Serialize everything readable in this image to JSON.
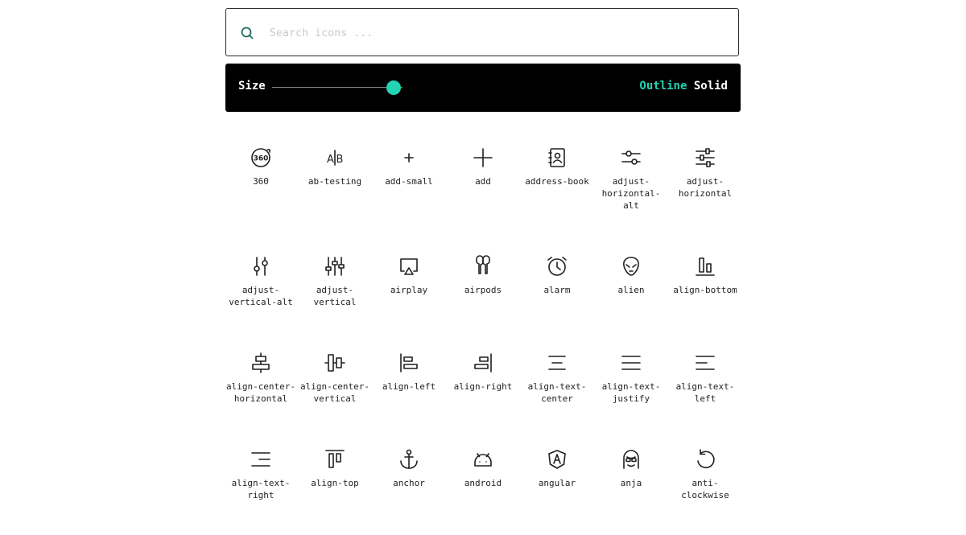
{
  "search": {
    "placeholder": "Search icons ...",
    "value": "",
    "icon": "search-icon"
  },
  "toolbar": {
    "size_label": "Size",
    "size_value_fraction": 0.93,
    "styles": [
      {
        "label": "Outline",
        "active": true
      },
      {
        "label": "Solid",
        "active": false
      }
    ]
  },
  "colors": {
    "accent": "#22d3b4",
    "toolbar_bg": "#000000",
    "icon_stroke": "#1f1f1f"
  },
  "icons": [
    {
      "name": "360"
    },
    {
      "name": "ab-testing"
    },
    {
      "name": "add-small"
    },
    {
      "name": "add"
    },
    {
      "name": "address-book"
    },
    {
      "name": "adjust-horizontal-alt"
    },
    {
      "name": "adjust-horizontal"
    },
    {
      "name": "adjust-vertical-alt"
    },
    {
      "name": "adjust-vertical"
    },
    {
      "name": "airplay"
    },
    {
      "name": "airpods"
    },
    {
      "name": "alarm"
    },
    {
      "name": "alien"
    },
    {
      "name": "align-bottom"
    },
    {
      "name": "align-center-horizontal"
    },
    {
      "name": "align-center-vertical"
    },
    {
      "name": "align-left"
    },
    {
      "name": "align-right"
    },
    {
      "name": "align-text-center"
    },
    {
      "name": "align-text-justify"
    },
    {
      "name": "align-text-left"
    },
    {
      "name": "align-text-right"
    },
    {
      "name": "align-top"
    },
    {
      "name": "anchor"
    },
    {
      "name": "android"
    },
    {
      "name": "angular"
    },
    {
      "name": "anja"
    },
    {
      "name": "anti-clockwise"
    }
  ]
}
